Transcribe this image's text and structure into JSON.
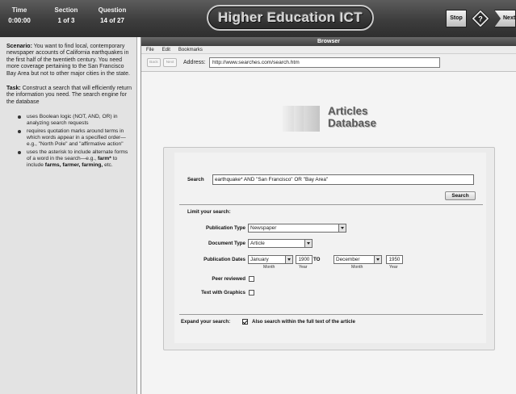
{
  "status": {
    "time_label": "Time",
    "time_value": "0:00:00",
    "section_label": "Section",
    "section_value": "1 of 3",
    "question_label": "Question",
    "question_value": "14 of 27"
  },
  "app_title": "Higher Education ICT",
  "controls": {
    "stop_label": "Stop",
    "help_icon": "question-mark-icon",
    "next_label": "Next"
  },
  "left_panel": {
    "scenario_label": "Scenario:",
    "scenario_text": "You want to find local, contemporary newspaper accounts of California earthquakes in the first half of the twentieth century. You need more coverage pertaining to the San Francisco Bay Area but not to other major cities in the state.",
    "task_label": "Task:",
    "task_text": "Construct a search that will efficiently return the information you need. The search engine for the database",
    "bullets": {
      "b1": "uses Boolean logic (NOT, AND, OR) in analyzing search requests",
      "b2": "requires quotation marks around terms in which words appear in a specified order—e.g., \"North Pole\" and \"affirmative action\"",
      "b3_pre": "uses the asterisk to include alternate forms of a word in the search—e.g.,",
      "b3_bold1": "farm*",
      "b3_mid": "to include",
      "b3_bold2": "farms, farmer, farming,",
      "b3_post": "etc."
    }
  },
  "browser": {
    "window_title": "Browser",
    "menu": {
      "file": "File",
      "edit": "Edit",
      "bookmarks": "Bookmarks"
    },
    "back_label": "Back",
    "next_label": "Next",
    "address_label": "Address:",
    "address_value": "http://www.searches.com/search.htm"
  },
  "logo": {
    "line1": "Articles",
    "line2": "Database"
  },
  "form": {
    "search_label": "Search",
    "search_value": "earthquake* AND \"San Francisco\" OR \"Bay Area\"",
    "search_button": "Search",
    "limit_label": "Limit your search:",
    "pub_type_label": "Publication Type",
    "pub_type_value": "Newspaper",
    "doc_type_label": "Document Type",
    "doc_type_value": "Article",
    "pub_dates_label": "Publication Dates",
    "from_month": "January",
    "from_year": "1900",
    "to_label": "TO",
    "to_month": "December",
    "to_year": "1950",
    "month_sub": "Month",
    "year_sub": "Year",
    "peer_label": "Peer reviewed",
    "graphics_label": "Text with Graphics",
    "expand_label": "Expand your search:",
    "expand_text": "Also search within the full text of the article",
    "expand_checked": true
  }
}
